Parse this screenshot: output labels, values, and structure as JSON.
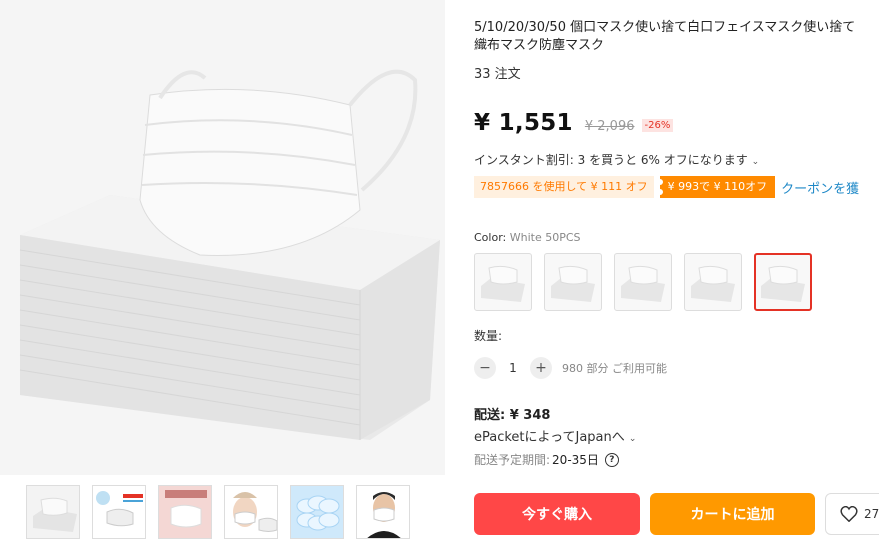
{
  "product": {
    "title_line1": "5/10/20/30/50 個口マスク使い捨て白口フェイスマスク使い捨て",
    "title_line2": "織布マスク防塵マスク",
    "orders": "33 注文"
  },
  "price": {
    "current": "¥ 1,551",
    "original": "¥ 2,096",
    "discount": "-26%"
  },
  "promo": {
    "instant_discount": "インスタント割引: 3 を買うと 6% オフになります",
    "coupon_code": "7857666 を使用して ¥ 111 オフ",
    "coupon_deal": "¥ 993で ¥ 110オフ",
    "coupon_link": "クーポンを獲"
  },
  "variant": {
    "label": "Color:",
    "selected": "White 50PCS",
    "swatch_count": 5,
    "selected_index": 4
  },
  "quantity": {
    "label": "数量:",
    "value": "1",
    "minus": "−",
    "plus": "+",
    "available": "980 部分 ご利用可能"
  },
  "shipping": {
    "cost": "配送: ¥ 348",
    "method": "ePacketによってJapanへ",
    "eta_label": "配送予定期間:",
    "eta_value": "20-35日",
    "help": "?"
  },
  "gallery": {
    "thumbnails": [
      "mask-pack",
      "blue-dust-flu-mask",
      "waterproof-mask",
      "woman-wearing-mask",
      "blue-stack-masks",
      "man-wearing-mask"
    ],
    "badge_thumb2_line1": "95%",
    "badge_thumb2_line2": "DUST FLU MASK",
    "badge_thumb3": "Waterproof"
  },
  "actions": {
    "buy_now": "今すぐ購入",
    "add_to_cart": "カートに追加",
    "wishlist_count": "27"
  },
  "colors": {
    "buy": "#ff4747",
    "cart": "#ff9900",
    "coupon": "#ff8a00",
    "link": "#1e88c7",
    "selected_border": "#e43225"
  }
}
